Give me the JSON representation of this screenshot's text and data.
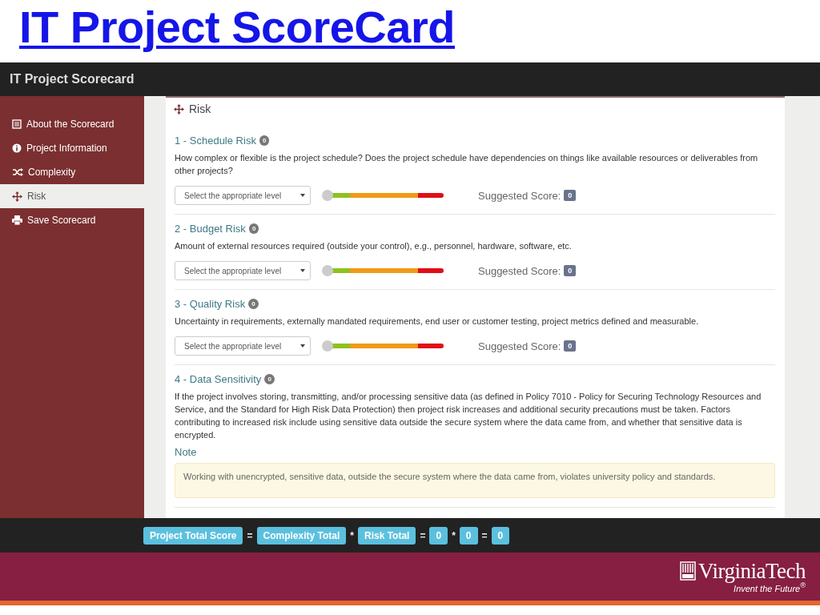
{
  "slide_title": "IT Project ScoreCard",
  "app": {
    "title": "IT Project Scorecard",
    "sidebar": {
      "items": [
        {
          "label": "About the Scorecard",
          "kind": "list",
          "selected": false
        },
        {
          "label": "Project Information",
          "kind": "info",
          "selected": false
        },
        {
          "label": "Complexity",
          "kind": "shuffle",
          "selected": false
        },
        {
          "label": "Risk",
          "kind": "move",
          "selected": true
        },
        {
          "label": "Save Scorecard",
          "kind": "print",
          "selected": false
        }
      ]
    },
    "section": {
      "title": "Risk",
      "questions": [
        {
          "title": "1 - Schedule Risk",
          "badge": "0",
          "description": "How complex or flexible is the project schedule? Does the project schedule have dependencies on things like available resources or deliverables from other projects?",
          "select": {
            "placeholder": "Select the appropriate level"
          },
          "slider": {
            "level": 0
          },
          "score_label": "Suggested Score:",
          "score": "0"
        },
        {
          "title": "2 - Budget Risk",
          "badge": "0",
          "description": "Amount of external resources required (outside your control), e.g., personnel, hardware, software, etc.",
          "select": {
            "placeholder": "Select the appropriate level"
          },
          "slider": {
            "level": 0
          },
          "score_label": "Suggested Score:",
          "score": "0"
        },
        {
          "title": "3 - Quality Risk",
          "badge": "0",
          "description": "Uncertainty in requirements, externally mandated requirements, end user or customer testing, project metrics defined and measurable.",
          "select": {
            "placeholder": "Select the appropriate level"
          },
          "slider": {
            "level": 0
          },
          "score_label": "Suggested Score:",
          "score": "0"
        },
        {
          "title": "4 - Data Sensitivity",
          "badge": "0",
          "description": "If the project involves storing, transmitting, and/or processing sensitive data (as defined in Policy 7010 - Policy for Securing Technology Resources and Service, and the Standard for High Risk Data Protection) then project risk increases and additional security precautions must be taken. Factors contributing to increased risk include using sensitive data outside the secure system where the data came from, and whether that sensitive data is encrypted.",
          "note_heading": "Note",
          "note": "Working with unencrypted, sensitive data, outside the secure system where the data came from, violates university policy and standards."
        }
      ]
    },
    "formula": [
      {
        "kind": "label",
        "text": "Project Total Score"
      },
      {
        "kind": "op",
        "text": "="
      },
      {
        "kind": "label",
        "text": "Complexity Total"
      },
      {
        "kind": "op",
        "text": "*"
      },
      {
        "kind": "label",
        "text": "Risk Total"
      },
      {
        "kind": "op",
        "text": "="
      },
      {
        "kind": "label",
        "text": "0"
      },
      {
        "kind": "op",
        "text": "*"
      },
      {
        "kind": "label",
        "text": "0"
      },
      {
        "kind": "op",
        "text": "="
      },
      {
        "kind": "label",
        "text": "0"
      }
    ]
  },
  "footer": {
    "logo_name": "VirginiaTech",
    "tagline": "Invent the Future",
    "tagline_mark": "®"
  }
}
